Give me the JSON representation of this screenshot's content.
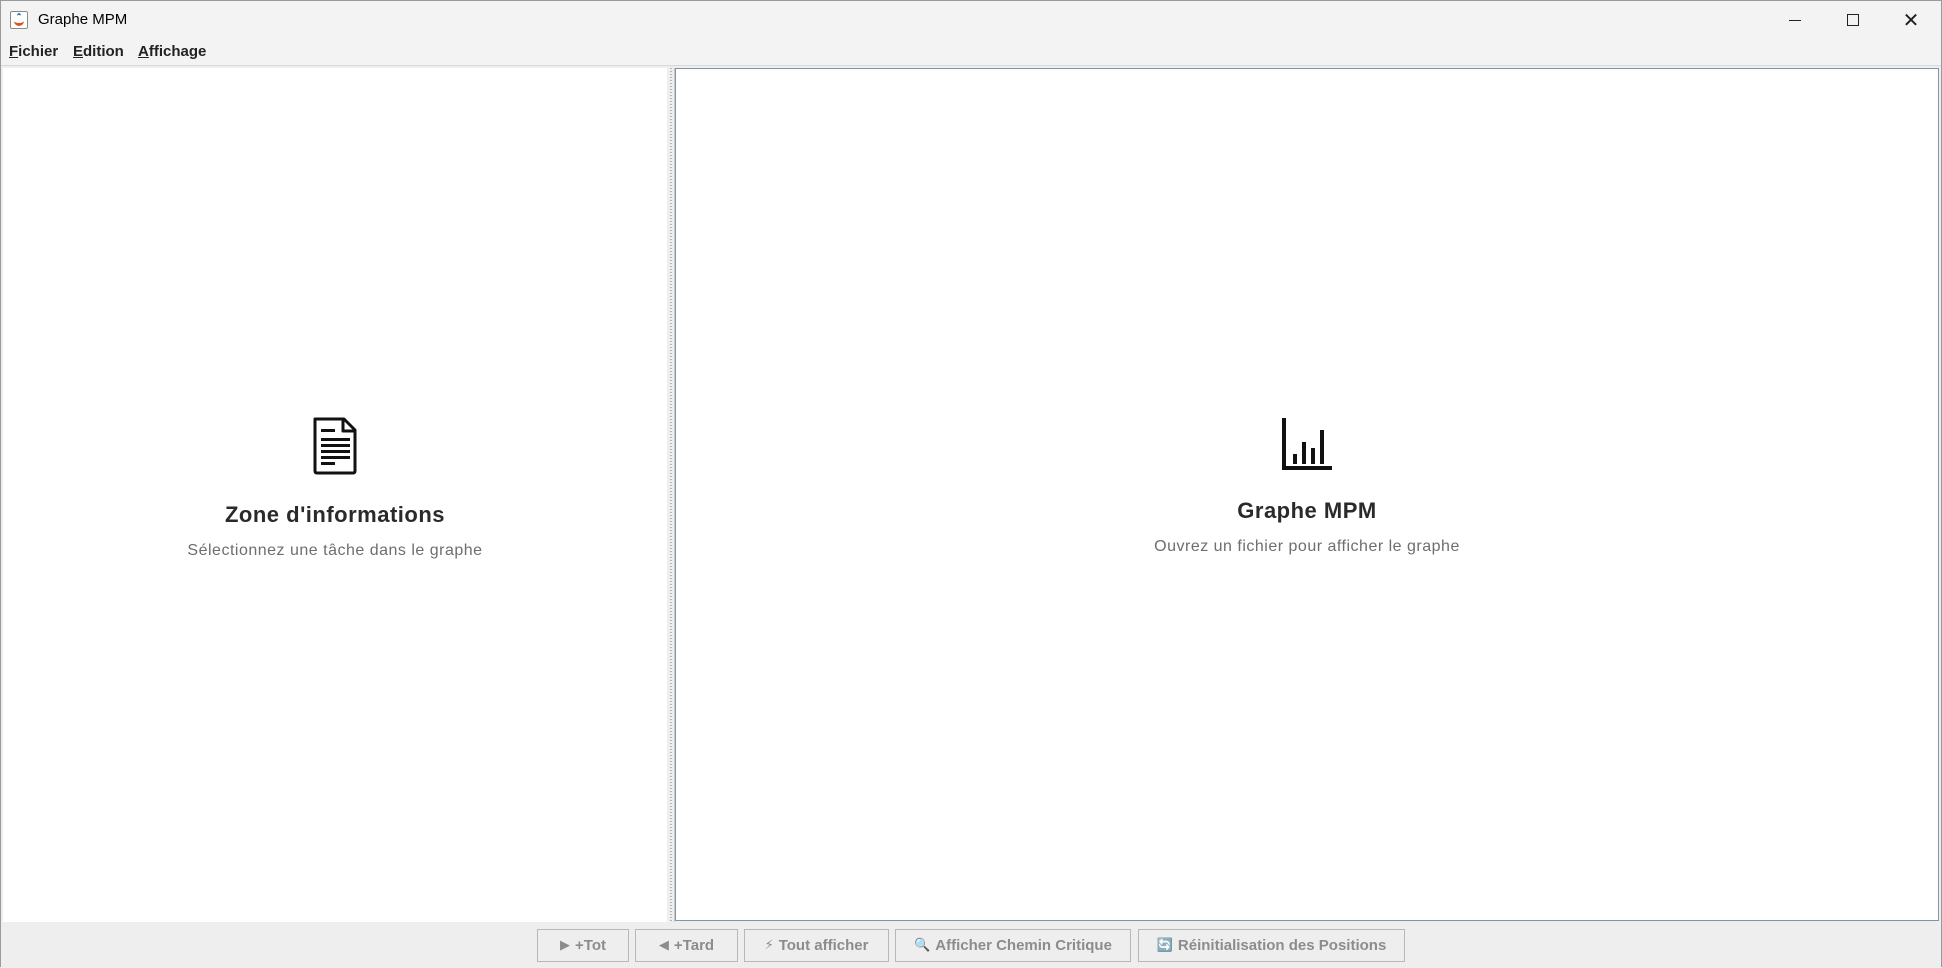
{
  "window": {
    "title": "Graphe MPM",
    "app_icon": "java-cup-icon"
  },
  "menubar": {
    "items": [
      {
        "mnemonic": "F",
        "rest": "ichier"
      },
      {
        "mnemonic": "E",
        "rest": "dition"
      },
      {
        "mnemonic": "A",
        "rest": "ffichage"
      }
    ]
  },
  "info_panel": {
    "icon": "document-icon",
    "title": "Zone d'informations",
    "subtitle": "Sélectionnez une tâche dans le graphe"
  },
  "graph_panel": {
    "icon": "bar-chart-icon",
    "title": "Graphe MPM",
    "subtitle": "Ouvrez un fichier pour afficher le graphe"
  },
  "toolbar": {
    "buttons": [
      {
        "glyph": "▶",
        "label": "+Tot",
        "icon": "play-right-icon"
      },
      {
        "glyph": "◀",
        "label": "+Tard",
        "icon": "play-left-icon"
      },
      {
        "glyph": "⚡",
        "label": "Tout afficher",
        "icon": "lightning-icon"
      },
      {
        "glyph": "🔍",
        "label": "Afficher Chemin Critique",
        "icon": "magnifier-icon"
      },
      {
        "glyph": "🔄",
        "label": "Réinitialisation des Positions",
        "icon": "refresh-icon"
      }
    ]
  }
}
